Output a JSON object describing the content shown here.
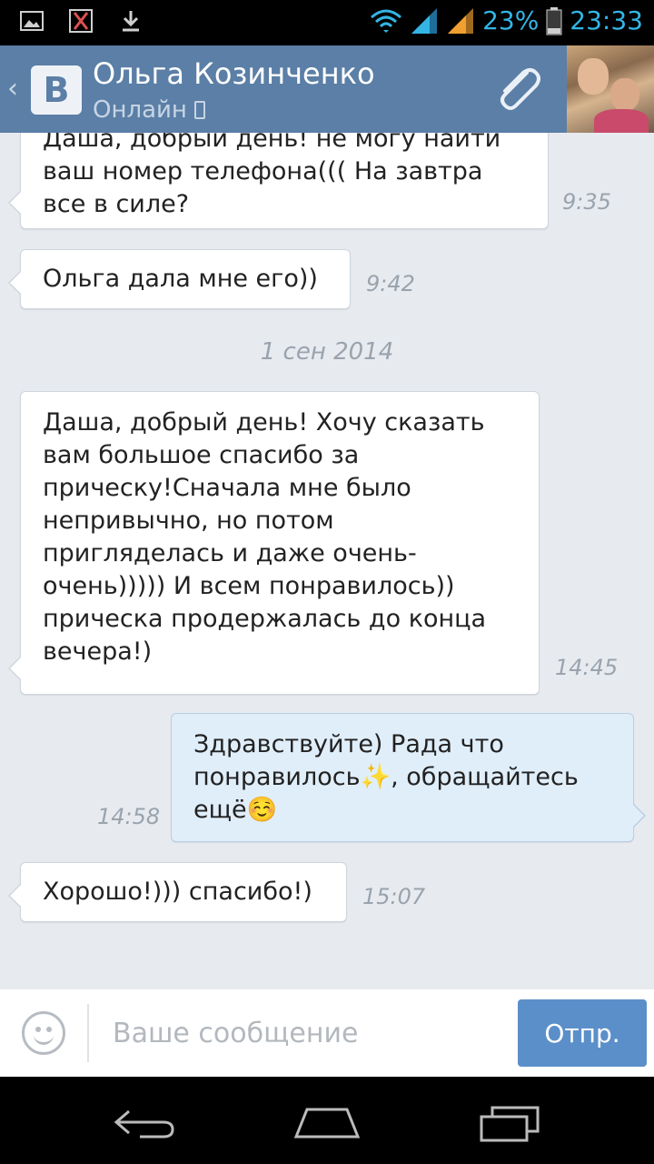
{
  "status_bar": {
    "battery_percent": "23%",
    "time": "23:33",
    "icons": [
      "image-notification-icon",
      "app-notification-icon",
      "download-icon",
      "wifi-icon",
      "signal-icon",
      "battery-icon"
    ]
  },
  "header": {
    "logo": "В",
    "name": "Ольга Козинченко",
    "status": "Онлайн",
    "icons": [
      "back-chevron-icon",
      "mobile-phone-icon",
      "attach-icon"
    ]
  },
  "messages": [
    {
      "direction": "in",
      "lines": [
        "Даша, добрый день! не могу найти",
        "ваш номер телефона((( На завтра",
        "все в силе?"
      ],
      "time": "9:35"
    },
    {
      "direction": "in",
      "lines": [
        "Ольга дала мне его))"
      ],
      "time": "9:42"
    },
    {
      "direction": "in",
      "lines": [
        "Даша, добрый день! Хочу сказать",
        "вам большое спасибо за",
        "прическу!Сначала мне было",
        "непривычно, но потом",
        "пригляделась и даже очень-",
        "очень))))) И всем понравилось))",
        "прическа продержалась до конца",
        "вечера!)"
      ],
      "time": "14:45"
    },
    {
      "direction": "out",
      "lines": [
        "Здравствуйте) Рада что",
        "понравилось✨, обращайтесь",
        "ещё☺️"
      ],
      "time": "14:58"
    },
    {
      "direction": "in",
      "lines": [
        "Хорошо!))) спасибо!)"
      ],
      "time": "15:07"
    }
  ],
  "date_separator": "1 сен 2014",
  "composer": {
    "placeholder": "Ваше сообщение",
    "value": "",
    "send_label": "Отпр."
  },
  "nav_bar": {
    "icons": [
      "back-icon",
      "home-icon",
      "recent-apps-icon"
    ]
  },
  "colors": {
    "header_bg": "#5b7fa6",
    "chat_bg": "#e7ebf0",
    "outgoing_bubble": "#e0eefa",
    "send_button": "#5b8fc9",
    "status_icons": "#33b5e5"
  }
}
